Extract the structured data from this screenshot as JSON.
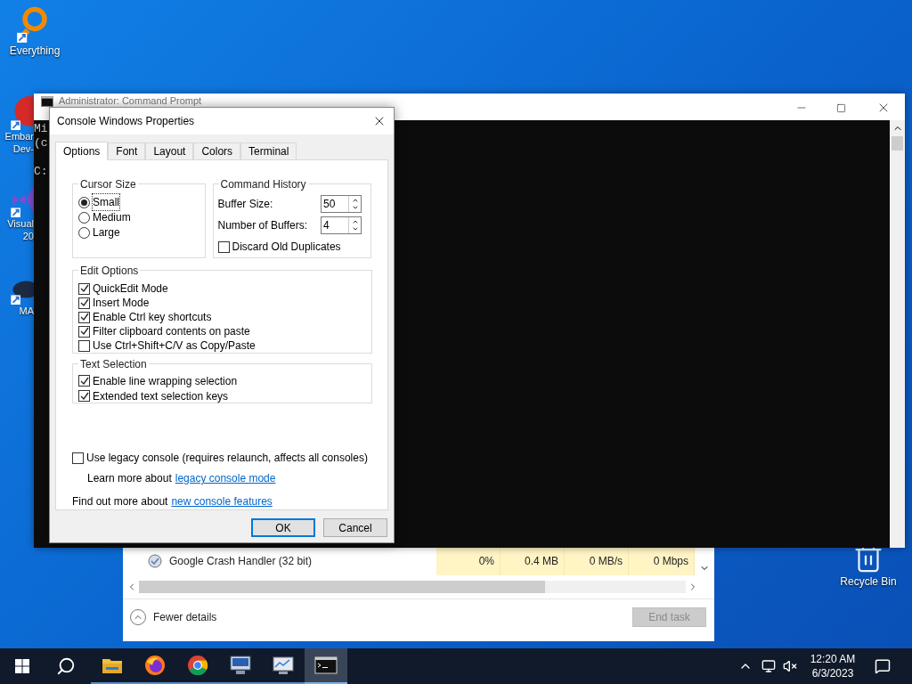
{
  "desktop_icons": [
    {
      "kind": "search",
      "lines": [
        "Everything"
      ]
    },
    {
      "kind": "red-badge",
      "lines": [
        "Embar",
        "Dev-"
      ]
    },
    {
      "kind": "purple",
      "lines": [
        "Visual",
        "20"
      ]
    },
    {
      "kind": "dark",
      "lines": [
        "MA"
      ]
    }
  ],
  "recycle_bin": {
    "label": "Recycle Bin"
  },
  "console_window": {
    "title": "Administrator: Command Prompt",
    "lines": [
      {
        "text": "Mi",
        "gap_before": false
      },
      {
        "text": "(c",
        "gap_before": false
      },
      {
        "text": "C:",
        "gap_before": true
      }
    ]
  },
  "task_manager": {
    "row": {
      "name": "Google Crash Handler (32 bit)",
      "cells": [
        "0%",
        "0.4 MB",
        "0 MB/s",
        "0 Mbps"
      ]
    },
    "fewer_details": "Fewer details",
    "end_task": {
      "label": "End task",
      "disabled": true
    }
  },
  "dialog": {
    "title": "Console Windows Properties",
    "tabs": [
      {
        "label": "Options",
        "selected": true
      },
      {
        "label": "Font",
        "selected": false
      },
      {
        "label": "Layout",
        "selected": false
      },
      {
        "label": "Colors",
        "selected": false
      },
      {
        "label": "Terminal",
        "selected": false
      }
    ],
    "cursor_size": {
      "title": "Cursor Size",
      "options": [
        {
          "label": "Small",
          "selected": true
        },
        {
          "label": "Medium",
          "selected": false
        },
        {
          "label": "Large",
          "selected": false
        }
      ]
    },
    "command_history": {
      "title": "Command History",
      "fields": [
        {
          "label": "Buffer Size:",
          "value": "50"
        },
        {
          "label": "Number of Buffers:",
          "value": "4"
        }
      ],
      "discard": {
        "label": "Discard Old Duplicates",
        "checked": false
      }
    },
    "edit_options": {
      "title": "Edit Options",
      "items": [
        {
          "label": "QuickEdit Mode",
          "checked": true
        },
        {
          "label": "Insert Mode",
          "checked": true
        },
        {
          "label": "Enable Ctrl key shortcuts",
          "checked": true
        },
        {
          "label": "Filter clipboard contents on paste",
          "checked": true
        },
        {
          "label": "Use Ctrl+Shift+C/V as Copy/Paste",
          "checked": false
        }
      ]
    },
    "text_selection": {
      "title": "Text Selection",
      "items": [
        {
          "label": "Enable line wrapping selection",
          "checked": true
        },
        {
          "label": "Extended text selection keys",
          "checked": true
        }
      ]
    },
    "legacy": {
      "label": "Use legacy console (requires relaunch, affects all consoles)",
      "checked": false
    },
    "learn_more": {
      "text": "Learn more about",
      "link": "legacy console mode"
    },
    "find_out": {
      "text": "Find out more about",
      "link": "new console features"
    },
    "buttons": [
      {
        "label": "OK",
        "default": true
      },
      {
        "label": "Cancel",
        "default": false
      }
    ]
  },
  "taskbar": {
    "apps": [
      {
        "kind": "folder",
        "active": false
      },
      {
        "kind": "firefox",
        "active": false
      },
      {
        "kind": "chrome",
        "active": false
      },
      {
        "kind": "monitor",
        "active": false
      },
      {
        "kind": "chart",
        "active": false
      },
      {
        "kind": "terminal",
        "active": true
      }
    ],
    "time": "12:20 AM",
    "date": "6/3/2023"
  }
}
